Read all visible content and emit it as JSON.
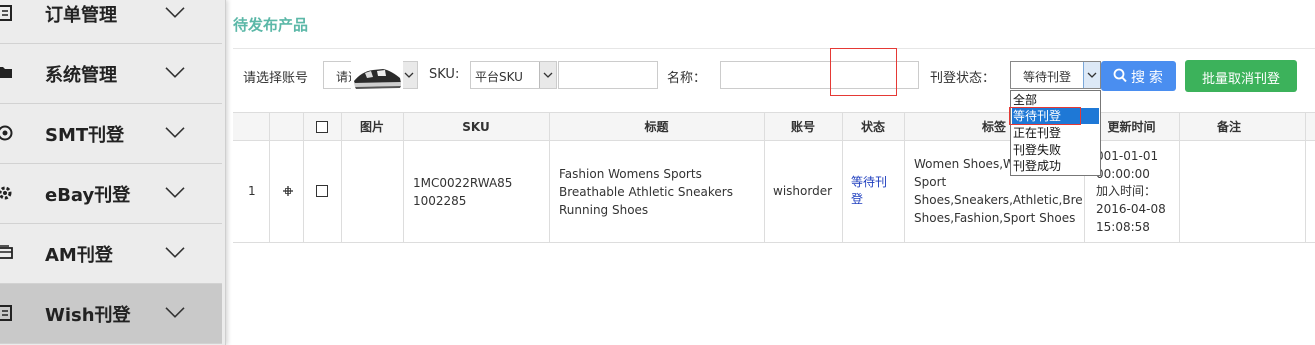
{
  "sidebar": {
    "items": [
      {
        "label": "订单管理",
        "icon": "document-list-icon"
      },
      {
        "label": "系统管理",
        "icon": "folder-icon"
      },
      {
        "label": "SMT刊登",
        "icon": "badge-icon"
      },
      {
        "label": "eBay刊登",
        "icon": "gear-icon"
      },
      {
        "label": "AM刊登",
        "icon": "wallet-icon"
      },
      {
        "label": "Wish刊登",
        "icon": "document-list-icon",
        "active": true
      }
    ]
  },
  "page": {
    "title": "待发布产品"
  },
  "filters": {
    "account_label": "请选择账号",
    "account_value": "请选择",
    "sku_label": "SKU:",
    "sku_type_value": "平台SKU",
    "sku_input_value": "",
    "name_label": "名称：",
    "name_input_value": "",
    "status_label": "刊登状态：",
    "status_value": "等待刊登",
    "status_options": [
      "全部",
      "等待刊登",
      "正在刊登",
      "刊登失败",
      "刊登成功"
    ],
    "search_button": "搜 索",
    "batch_button": "批量取消刊登"
  },
  "table": {
    "columns": [
      "",
      "",
      "",
      "图片",
      "SKU",
      "标题",
      "账号",
      "状态",
      "标签",
      "更新时间",
      "备注"
    ],
    "rows": [
      {
        "index": "1",
        "expand_icon": "plus-icon",
        "sku_line1": "1MC0022RWA85",
        "sku_line2": "1002285",
        "title_line1": "Fashion Womens Sports",
        "title_line2": "Breathable Athletic Sneakers",
        "title_line3": "Running Shoes",
        "account": "wishorder",
        "status_line1": "等待刊",
        "status_line2": "登",
        "tags_line1": "Women Shoes,W",
        "tags_line2": "Sport",
        "tags_line3": "Shoes,Sneakers,Athletic,Brea",
        "tags_line4": "Shoes,Fashion,Sport Shoes",
        "update_line1": "001-01-01",
        "update_line2": "00:00:00",
        "update_line3": "加入时间：",
        "update_line4": "2016-04-08",
        "update_line5": "15:08:58",
        "note": ""
      }
    ]
  },
  "colors": {
    "title": "#5cb8a8",
    "search": "#4a8ef0",
    "batch": "#3cb25b",
    "highlight": "#e53935"
  }
}
